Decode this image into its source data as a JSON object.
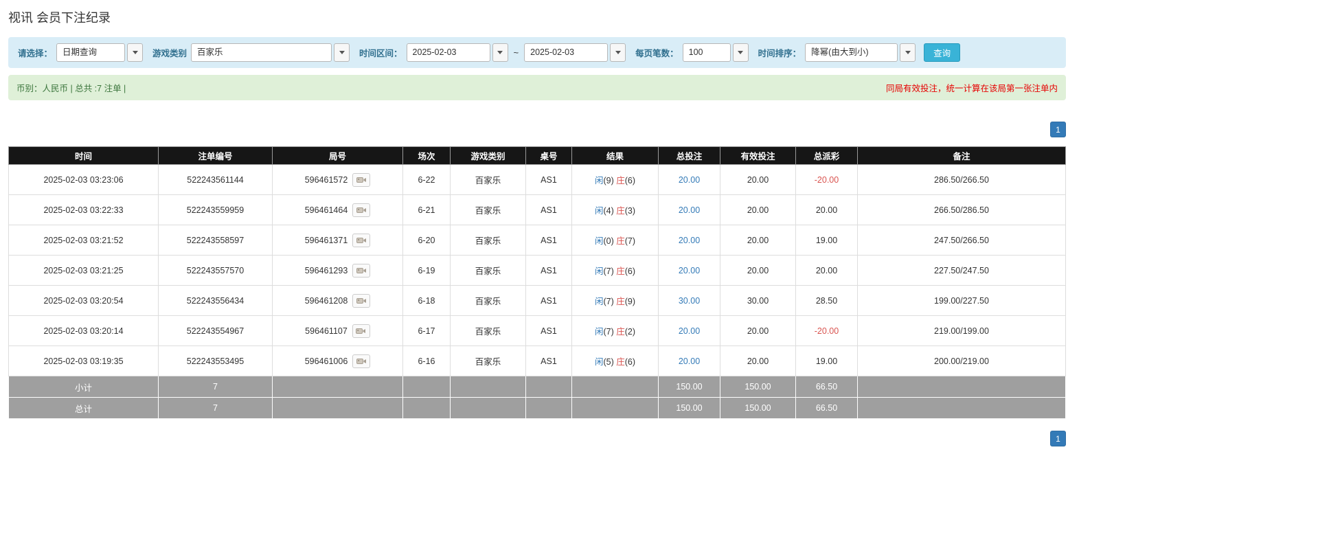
{
  "page_title": "视讯 会员下注纪录",
  "filters": {
    "select_label": "请选择：",
    "select_value": "日期查询",
    "game_label": "游戏类别",
    "game_value": "百家乐",
    "range_label": "时间区间：",
    "date_from": "2025-02-03",
    "range_separator": "~",
    "date_to": "2025-02-03",
    "page_size_label": "每页笔数：",
    "page_size_value": "100",
    "sort_label": "时间排序：",
    "sort_value": "降幂(由大到小)",
    "search_button": "查询"
  },
  "summary": {
    "currency_info": "币别：人民币 | 总共 :7 注单 |",
    "notice": "同局有效投注，统一计算在该局第一张注单内"
  },
  "pagination": {
    "current_page": "1"
  },
  "colors": {
    "accent_blue": "#337ab7",
    "player_blue": "#337ab7",
    "banker_red": "#d9534f",
    "negative_red": "#d9534f",
    "notice_red": "#e60000",
    "header_black": "#161616",
    "footer_gray": "#9f9f9f",
    "filter_bg": "#d9edf7",
    "summary_bg": "#dff0d8"
  },
  "table": {
    "headers": [
      "时间",
      "注单编号",
      "局号",
      "场次",
      "游戏类别",
      "桌号",
      "结果",
      "总投注",
      "有效投注",
      "总派彩",
      "备注"
    ],
    "rows": [
      {
        "time": "2025-02-03 03:23:06",
        "bet_id": "522243561144",
        "round_id": "596461572",
        "session": "6-22",
        "game": "百家乐",
        "table_code": "AS1",
        "result": {
          "player": "闲",
          "player_score": "(9)",
          "banker": "庄",
          "banker_score": "(6)"
        },
        "total_bet": "20.00",
        "valid_bet": "20.00",
        "payout": "-20.00",
        "note": "286.50/266.50"
      },
      {
        "time": "2025-02-03 03:22:33",
        "bet_id": "522243559959",
        "round_id": "596461464",
        "session": "6-21",
        "game": "百家乐",
        "table_code": "AS1",
        "result": {
          "player": "闲",
          "player_score": "(4)",
          "banker": "庄",
          "banker_score": "(3)"
        },
        "total_bet": "20.00",
        "valid_bet": "20.00",
        "payout": "20.00",
        "note": "266.50/286.50"
      },
      {
        "time": "2025-02-03 03:21:52",
        "bet_id": "522243558597",
        "round_id": "596461371",
        "session": "6-20",
        "game": "百家乐",
        "table_code": "AS1",
        "result": {
          "player": "闲",
          "player_score": "(0)",
          "banker": "庄",
          "banker_score": "(7)"
        },
        "total_bet": "20.00",
        "valid_bet": "20.00",
        "payout": "19.00",
        "note": "247.50/266.50"
      },
      {
        "time": "2025-02-03 03:21:25",
        "bet_id": "522243557570",
        "round_id": "596461293",
        "session": "6-19",
        "game": "百家乐",
        "table_code": "AS1",
        "result": {
          "player": "闲",
          "player_score": "(7)",
          "banker": "庄",
          "banker_score": "(6)"
        },
        "total_bet": "20.00",
        "valid_bet": "20.00",
        "payout": "20.00",
        "note": "227.50/247.50"
      },
      {
        "time": "2025-02-03 03:20:54",
        "bet_id": "522243556434",
        "round_id": "596461208",
        "session": "6-18",
        "game": "百家乐",
        "table_code": "AS1",
        "result": {
          "player": "闲",
          "player_score": "(7)",
          "banker": "庄",
          "banker_score": "(9)"
        },
        "total_bet": "30.00",
        "valid_bet": "30.00",
        "payout": "28.50",
        "note": "199.00/227.50"
      },
      {
        "time": "2025-02-03 03:20:14",
        "bet_id": "522243554967",
        "round_id": "596461107",
        "session": "6-17",
        "game": "百家乐",
        "table_code": "AS1",
        "result": {
          "player": "闲",
          "player_score": "(7)",
          "banker": "庄",
          "banker_score": "(2)"
        },
        "total_bet": "20.00",
        "valid_bet": "20.00",
        "payout": "-20.00",
        "note": "219.00/199.00"
      },
      {
        "time": "2025-02-03 03:19:35",
        "bet_id": "522243553495",
        "round_id": "596461006",
        "session": "6-16",
        "game": "百家乐",
        "table_code": "AS1",
        "result": {
          "player": "闲",
          "player_score": "(5)",
          "banker": "庄",
          "banker_score": "(6)"
        },
        "total_bet": "20.00",
        "valid_bet": "20.00",
        "payout": "19.00",
        "note": "200.00/219.00"
      }
    ],
    "subtotal": {
      "label": "小计",
      "count": "7",
      "total_bet": "150.00",
      "valid_bet": "150.00",
      "payout": "66.50"
    },
    "grand_total": {
      "label": "总计",
      "count": "7",
      "total_bet": "150.00",
      "valid_bet": "150.00",
      "payout": "66.50"
    }
  }
}
